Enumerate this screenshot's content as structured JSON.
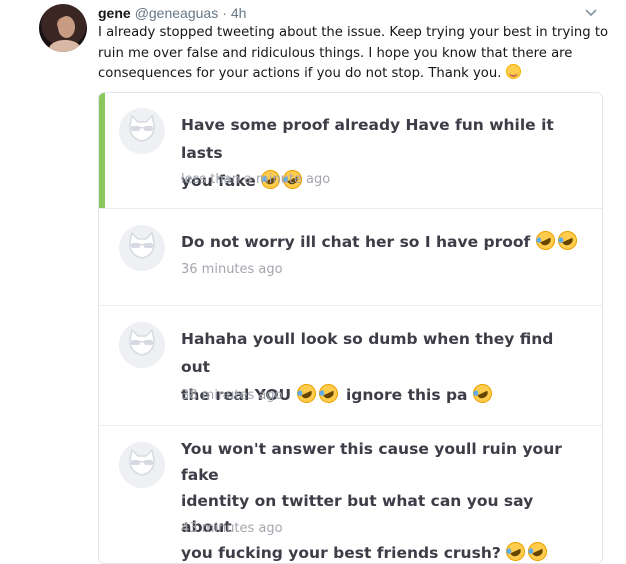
{
  "tweet": {
    "author_name": "gene",
    "author_handle": "@geneaguas",
    "separator": "·",
    "timestamp": "4h",
    "text": "I already stopped tweeting about the issue. Keep trying your best in trying to ruin me over false and ridiculous things. I hope you know that there are consequences for your actions if you do not stop. Thank you.",
    "avatar_icon": "profile-photo",
    "menu_icon": "chevron-down-icon",
    "emoji": "smiling-face-icon"
  },
  "messages": [
    {
      "text_line1": "Have some proof already Have fun while it lasts",
      "text_line2": "you fake",
      "emoji_count": 2,
      "time": "less than a minute ago"
    },
    {
      "text_line1": "Do not worry ill chat her so I have proof",
      "emoji_count": 2,
      "time": "36 minutes ago"
    },
    {
      "text_line1": "Hahaha youll look so dumb when they find out",
      "text_line2a": "the real YOU",
      "text_line2b": "ignore this pa",
      "time": "38 minutes ago"
    },
    {
      "text_line1": "You won't answer this cause youll ruin your fake",
      "text_line2": "identity on twitter but what can you say about",
      "text_line3": "you fucking your best friends crush?",
      "time": "43 minutes ago"
    }
  ],
  "colors": {
    "accent_bar": "#8ac65a",
    "message_text": "#3d3d48",
    "time_text": "#a3a6ad",
    "muted": "#657786"
  },
  "icons": {
    "anon_avatar": "anonymous-cat-with-sunglasses-icon",
    "laughing_emoji": "rolling-on-floor-laughing-icon"
  }
}
